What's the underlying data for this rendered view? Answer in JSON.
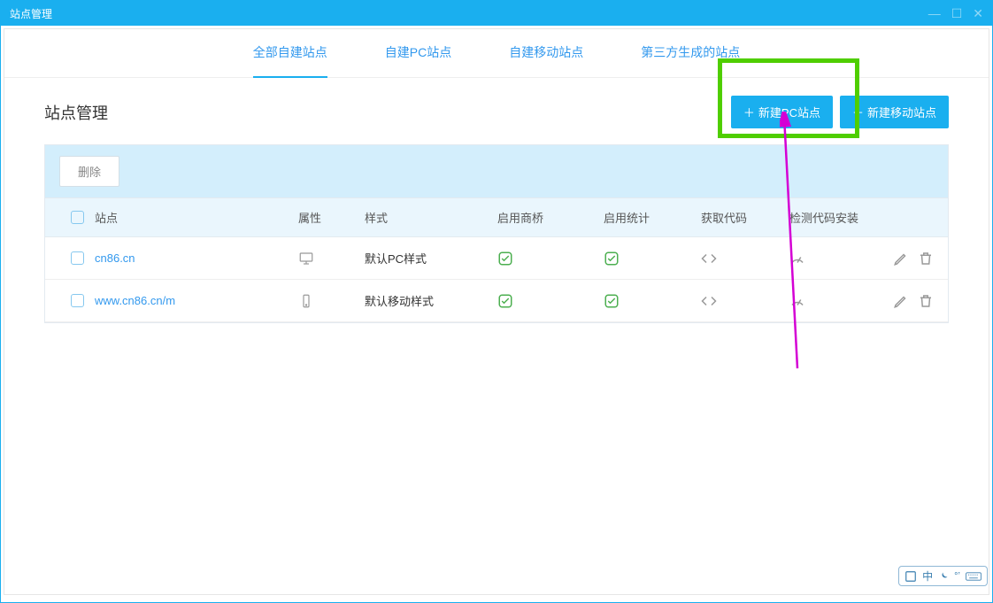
{
  "window": {
    "title": "站点管理"
  },
  "tabs": {
    "all": "全部自建站点",
    "pc": "自建PC站点",
    "mobile": "自建移动站点",
    "third": "第三方生成的站点"
  },
  "section": {
    "title": "站点管理"
  },
  "buttons": {
    "new_pc": "新建PC站点",
    "new_mobile": "新建移动站点",
    "delete": "删除"
  },
  "columns": {
    "site": "站点",
    "attr": "属性",
    "style": "样式",
    "qiao": "启用商桥",
    "stat": "启用统计",
    "code": "获取代码",
    "check": "检测代码安装"
  },
  "rows": [
    {
      "site": "cn86.cn",
      "style": "默认PC样式",
      "device": "desktop"
    },
    {
      "site": "www.cn86.cn/m",
      "style": "默认移动样式",
      "device": "mobile"
    }
  ],
  "ime": {
    "lang": "中"
  }
}
